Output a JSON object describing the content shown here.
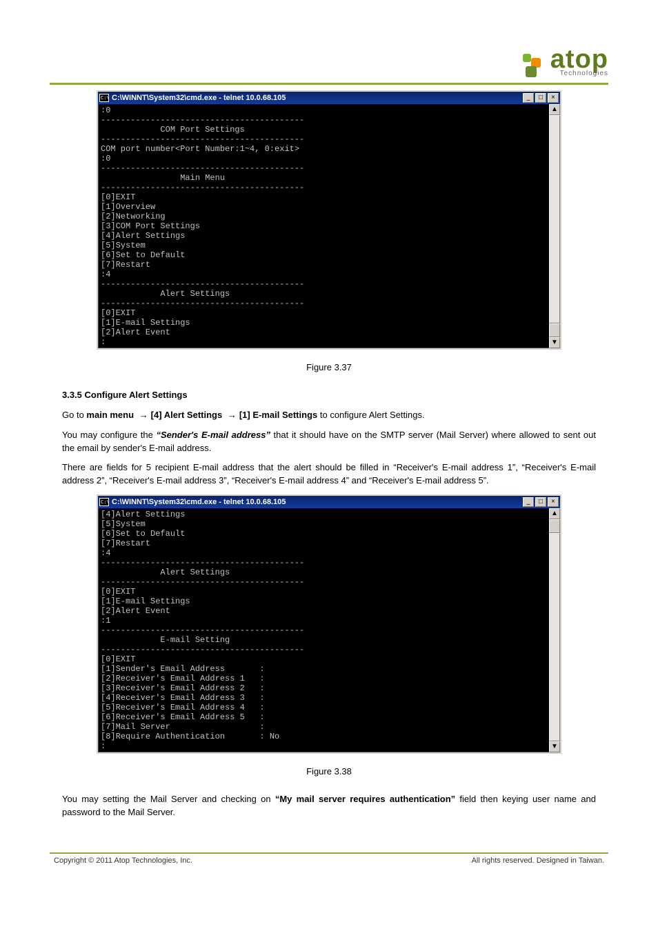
{
  "brand": {
    "name": "atop",
    "sub": "Technologies",
    "logoName": "atop-logo"
  },
  "fig37": {
    "label": "Figure 3.37"
  },
  "fig38": {
    "label": "Figure 3.38"
  },
  "cmd1": {
    "title": "C:\\WINNT\\System32\\cmd.exe - telnet 10.0.68.105",
    "btns": {
      "min": "_",
      "max": "□",
      "close": "×"
    },
    "body": ":0\n-----------------------------------------\n            COM Port Settings\n-----------------------------------------\nCOM port number<Port Number:1~4, 0:exit>\n:0\n-----------------------------------------\n                Main Menu\n-----------------------------------------\n[0]EXIT\n[1]Overview\n[2]Networking\n[3]COM Port Settings\n[4]Alert Settings\n[5]System\n[6]Set to Default\n[7]Restart\n:4\n-----------------------------------------\n            Alert Settings\n-----------------------------------------\n[0]EXIT\n[1]E-mail Settings\n[2]Alert Event\n:"
  },
  "cmd2": {
    "title": "C:\\WINNT\\System32\\cmd.exe - telnet 10.0.68.105",
    "btns": {
      "min": "_",
      "max": "□",
      "close": "×"
    },
    "body": "[4]Alert Settings\n[5]System\n[6]Set to Default\n[7]Restart\n:4\n-----------------------------------------\n            Alert Settings\n-----------------------------------------\n[0]EXIT\n[1]E-mail Settings\n[2]Alert Event\n:1\n-----------------------------------------\n            E-mail Setting\n-----------------------------------------\n[0]EXIT\n[1]Sender's Email Address       :\n[2]Receiver's Email Address 1   :\n[3]Receiver's Email Address 2   :\n[4]Receiver's Email Address 3   :\n[5]Receiver's Email Address 4   :\n[6]Receiver's Email Address 5   :\n[7]Mail Server                  :\n[8]Require Authentication       : No\n:"
  },
  "section": {
    "heading": "3.3.5 Configure Alert Settings",
    "p1a": "Go to ",
    "p1b": "main menu ",
    "p1c": "[4] Alert Settings ",
    "p1d": "[1] E-mail Settings",
    "p1e": " to configure Alert Settings.",
    "p2a": "You may configure the ",
    "p2b": "“Sender's E-mail address”",
    "p2c": " that it should have on the SMTP server (Mail Server) where allowed to sent out the email by sender's E-mail address.",
    "p3": "There are fields for 5 recipient E-mail address that the alert should be filled in “Receiver's E-mail address 1”, “Receiver's E-mail address 2”, “Receiver's E-mail address 3”, “Receiver's E-mail address 4” and “Receiver's E-mail address 5”.",
    "p4a": "You may setting the Mail Server and checking on ",
    "p4b": "“My mail server requires authentication”",
    "p4c": " field then keying user name and password to the Mail Server.",
    "arrow": "→"
  },
  "footer": {
    "left": "Copyright © 2011 Atop Technologies, Inc.",
    "right": "All rights reserved. Designed in Taiwan."
  }
}
